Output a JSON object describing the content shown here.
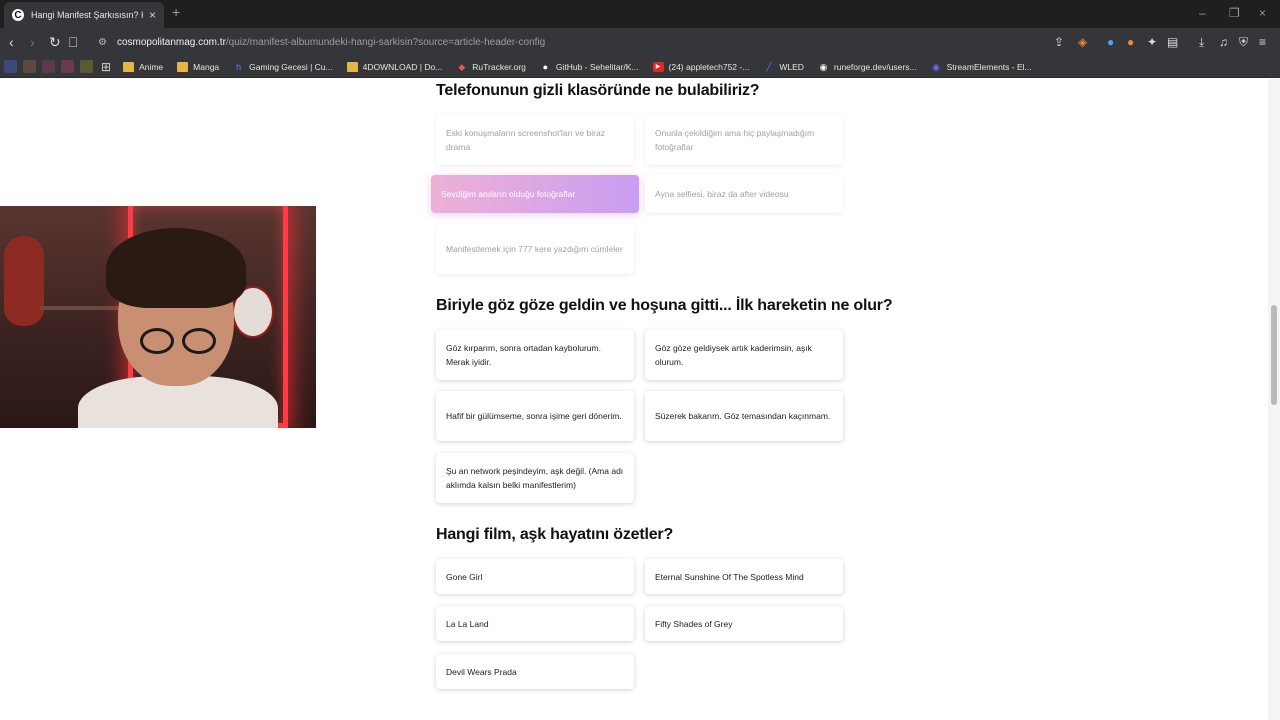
{
  "browser": {
    "tab": {
      "favicon_letter": "C",
      "title": "Hangi Manifest Şarkısısın? Kendi"
    },
    "url": {
      "host": "cosmopolitanmag.com.tr",
      "path": "/quiz/manifest-albumundeki-hangi-sarkisin?source=article-header-config"
    },
    "bookmarks": [
      {
        "label": "Anime",
        "icon": "folder-icon"
      },
      {
        "label": "Manga",
        "icon": "folder-icon"
      },
      {
        "label": "Gaming Gecesi | Cu...",
        "icon": "site-icon"
      },
      {
        "label": "4DOWNLOAD | Do...",
        "icon": "folder-icon"
      },
      {
        "label": "RuTracker.org",
        "icon": "site-icon"
      },
      {
        "label": "GitHub - Sehelitar/K...",
        "icon": "github-icon"
      },
      {
        "label": "(24) appletech752 -...",
        "icon": "youtube-icon"
      },
      {
        "label": "WLED",
        "icon": "site-icon"
      },
      {
        "label": "runeforge.dev/users...",
        "icon": "site-icon"
      },
      {
        "label": "StreamElements - El...",
        "icon": "site-icon"
      }
    ]
  },
  "quiz": {
    "q1": {
      "title": "Telefonunun gizli klasöründe ne bulabiliriz?",
      "options": [
        "Eski konuşmaların screenshot'ları ve biraz drama",
        "Onunla çekildiğim ama hiç paylaşmadığım fotoğraflar",
        "Sevdiğim anıların olduğu fotoğraflar",
        "Ayna selfiesi, biraz da after videosu",
        "Manifestlemek için 777 kere yazdığım cümleler"
      ]
    },
    "q2": {
      "title": "Biriyle göz göze geldin ve hoşuna gitti... İlk hareketin ne olur?",
      "options": [
        "Göz kırparım, sonra ortadan kaybolurum. Merak iyidir.",
        "Göz göze geldiysek artık kaderimsin, aşık olurum.",
        "Hafif bir gülümseme, sonra işime geri dönerim.",
        "Süzerek bakarım. Göz temasından kaçınmam.",
        "Şu an network peşindeyim, aşk değil. (Ama adı aklımda kalsın belki manifestlerim)"
      ]
    },
    "q3": {
      "title": "Hangi film, aşk hayatını özetler?",
      "options": [
        "Gone Girl",
        "Eternal Sunshine Of The Spotless Mind",
        "La La Land",
        "Fifty Shades of Grey",
        "Devil Wears Prada"
      ]
    }
  },
  "colors": {
    "selected_gradient_start": "#efb0d6",
    "selected_gradient_end": "#c99df2",
    "chrome_dark": "#35363a"
  }
}
